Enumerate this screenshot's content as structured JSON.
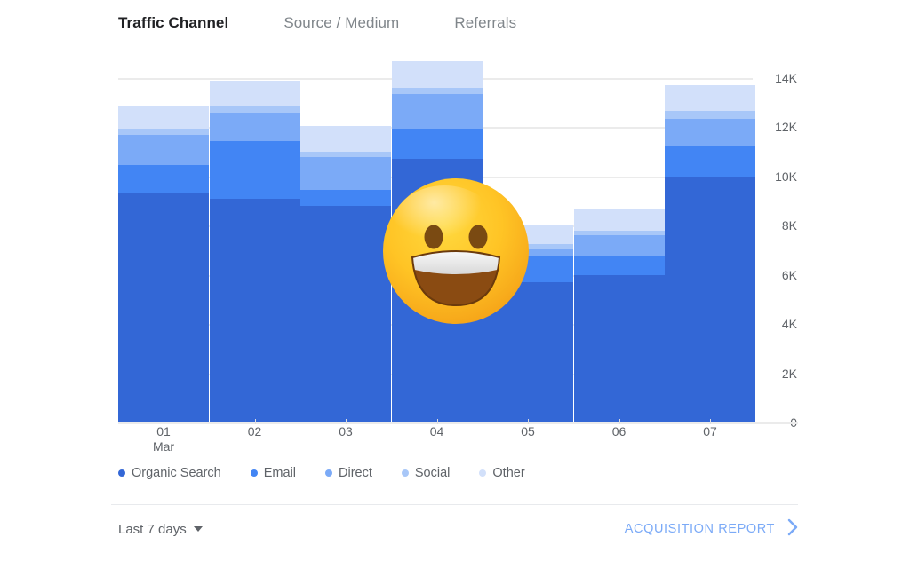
{
  "tabs": [
    {
      "label": "Traffic Channel",
      "active": true
    },
    {
      "label": "Source / Medium",
      "active": false
    },
    {
      "label": "Referrals",
      "active": false
    }
  ],
  "footer": {
    "date_range": "Last 7 days",
    "caret_icon": "chevron-down-icon",
    "report_label": "ACQUISITION REPORT",
    "chevron_icon": "chevron-right-icon"
  },
  "overlay": {
    "emoji_name": "grinning-face-emoji",
    "emoji_glyph": "😀"
  },
  "colors": {
    "organic_search": "#3367d6",
    "email": "#4285f4",
    "direct": "#7baaf7",
    "social": "#a8c7f8",
    "other": "#d2e0fa",
    "gridline": "#ebebeb",
    "axis_text": "#5f6368",
    "active_tab": "#202124",
    "inactive_tab": "#80868b",
    "link": "#7baaf7"
  },
  "chart_data": {
    "type": "bar",
    "stacked": true,
    "title": "Traffic Channel",
    "xlabel": "",
    "ylabel": "",
    "ylim": [
      0,
      14000
    ],
    "grid": true,
    "legend_position": "bottom",
    "categories": [
      "01",
      "02",
      "03",
      "04",
      "05",
      "06",
      "07"
    ],
    "category_sublabels": [
      "Mar",
      "",
      "",
      "",
      "",
      "",
      ""
    ],
    "ytick_labels": [
      "14K",
      "12K",
      "10K",
      "8K",
      "6K",
      "4K",
      "2K",
      "0"
    ],
    "ytick_values": [
      14000,
      12000,
      10000,
      8000,
      6000,
      4000,
      2000,
      0
    ],
    "series": [
      {
        "name": "Organic Search",
        "color": "#3367d6",
        "values": [
          9300,
          9100,
          8800,
          10700,
          5700,
          6000,
          10000
        ]
      },
      {
        "name": "Email",
        "color": "#4285f4",
        "values": [
          1150,
          2350,
          650,
          1250,
          1100,
          800,
          1250
        ]
      },
      {
        "name": "Direct",
        "color": "#7baaf7",
        "values": [
          1250,
          1150,
          1350,
          1400,
          250,
          800,
          1100
        ]
      },
      {
        "name": "Social",
        "color": "#a8c7f8",
        "values": [
          250,
          250,
          200,
          250,
          200,
          200,
          300
        ]
      },
      {
        "name": "Other",
        "color": "#d2e0fa",
        "values": [
          900,
          1050,
          1050,
          1100,
          750,
          900,
          1050
        ]
      }
    ],
    "totals": [
      12850,
      13900,
      12050,
      14700,
      8000,
      8700,
      13700
    ]
  }
}
